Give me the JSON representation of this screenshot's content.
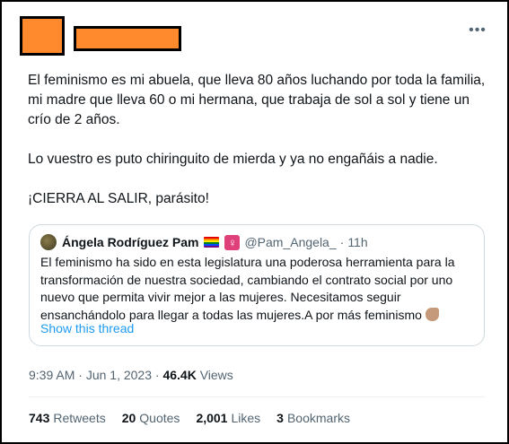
{
  "tweet": {
    "paragraphs": [
      "El feminismo es mi abuela, que lleva 80 años luchando por toda la familia, mi madre que lleva 60 o mi hermana, que trabaja de sol a sol y tiene un crío de 2 años.",
      "Lo vuestro es puto chiringuito de mierda y ya no engañáis a nadie.",
      "¡CIERRA AL SALIR, parásito!"
    ],
    "more_icon": "more-horizontal-icon",
    "redaction_color": "#ff8a2e"
  },
  "quote": {
    "name": "Ángela Rodríguez Pam",
    "handle": "@Pam_Angela_",
    "separator": "·",
    "time": "11h",
    "body": "El feminismo ha sido en esta legislatura una poderosa herramienta para la transformación de nuestra sociedad, cambiando el contrato social por uno nuevo que permita vivir mejor a las mujeres. Necesitamos seguir ensanchándolo para llegar a todas las  mujeres.A por más feminismo",
    "show_thread": "Show this thread",
    "icons": [
      "rainbow-flag-icon",
      "venus-icon",
      "flexed-biceps-icon"
    ]
  },
  "meta": {
    "time": "9:39 AM",
    "separator": "·",
    "date": "Jun 1, 2023",
    "views_count": "46.4K",
    "views_label": "Views"
  },
  "stats": [
    {
      "count": "743",
      "label": "Retweets"
    },
    {
      "count": "20",
      "label": "Quotes"
    },
    {
      "count": "2,001",
      "label": "Likes"
    },
    {
      "count": "3",
      "label": "Bookmarks"
    }
  ],
  "colors": {
    "text": "#0f1419",
    "secondary": "#536471",
    "link": "#1d9bf0",
    "border": "#cfd9de"
  }
}
